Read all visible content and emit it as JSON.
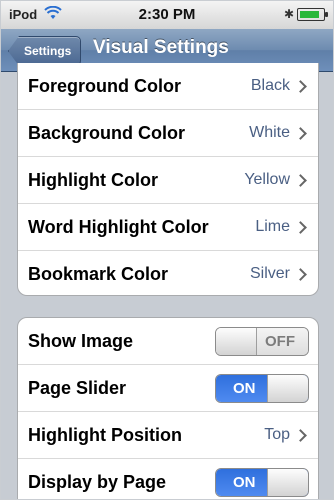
{
  "status_bar": {
    "carrier": "iPod",
    "time": "2:30 PM",
    "icons": [
      "wifi-icon",
      "bluetooth-icon",
      "battery-icon"
    ],
    "battery_level": 0.85
  },
  "nav": {
    "back_label": "Settings",
    "title": "Visual Settings"
  },
  "colors_group": [
    {
      "label": "Foreground Color",
      "value": "Black"
    },
    {
      "label": "Background Color",
      "value": "White"
    },
    {
      "label": "Highlight Color",
      "value": "Yellow"
    },
    {
      "label": "Word Highlight Color",
      "value": "Lime"
    },
    {
      "label": "Bookmark Color",
      "value": "Silver"
    }
  ],
  "options_group": [
    {
      "label": "Show Image",
      "type": "switch",
      "state": "OFF"
    },
    {
      "label": "Page Slider",
      "type": "switch",
      "state": "ON"
    },
    {
      "label": "Highlight Position",
      "type": "disclosure",
      "value": "Top"
    },
    {
      "label": "Display by Page",
      "type": "switch",
      "state": "ON"
    }
  ],
  "theme": {
    "nav_color": "#6d8bb0",
    "switch_on_color": "#3a7be8",
    "value_text_color": "#4a5f83"
  }
}
